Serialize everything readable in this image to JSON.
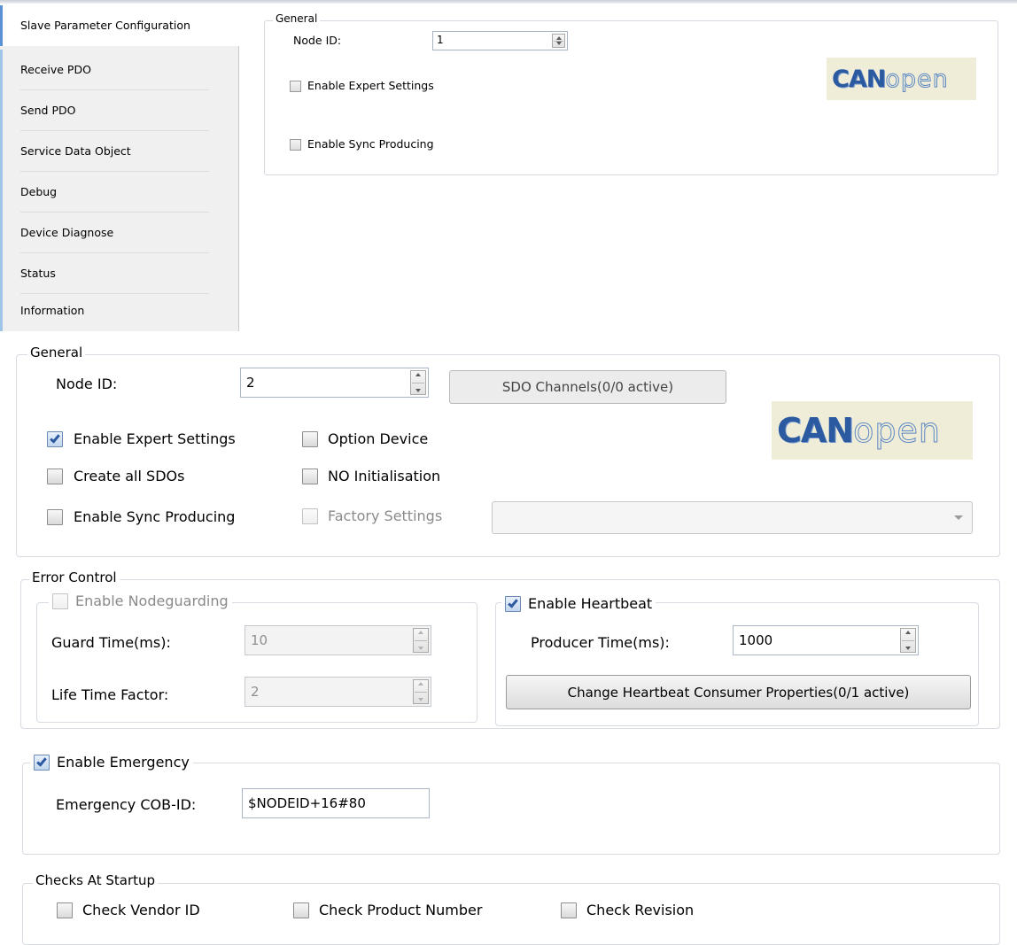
{
  "sidebar": {
    "items": [
      {
        "label": "Slave Parameter Configuration"
      },
      {
        "label": "Receive PDO"
      },
      {
        "label": "Send PDO"
      },
      {
        "label": "Service Data Object"
      },
      {
        "label": "Debug"
      },
      {
        "label": "Device Diagnose"
      },
      {
        "label": "Status"
      },
      {
        "label": "Information"
      }
    ]
  },
  "small_view": {
    "general_legend": "General",
    "node_id_label": "Node ID:",
    "node_id_value": "1",
    "enable_expert_label": "Enable Expert Settings",
    "enable_expert_checked": false,
    "enable_sync_label": "Enable Sync Producing",
    "enable_sync_checked": false,
    "logo_can": "CAN",
    "logo_open": "open"
  },
  "general": {
    "legend": "General",
    "node_id_label": "Node ID:",
    "node_id_value": "2",
    "sdo_button": "SDO Channels(0/0 active)",
    "enable_expert_label": "Enable Expert Settings",
    "enable_expert_checked": true,
    "option_device_label": "Option Device",
    "create_all_sdos_label": "Create all SDOs",
    "no_init_label": "NO Initialisation",
    "enable_sync_label": "Enable Sync Producing",
    "factory_settings_label": "Factory Settings",
    "factory_settings_value": "",
    "logo_can": "CAN",
    "logo_open": "open"
  },
  "error_control": {
    "legend": "Error Control",
    "nodeguarding_label": "Enable Nodeguarding",
    "nodeguarding_checked": false,
    "guard_time_label": "Guard Time(ms):",
    "guard_time_value": "10",
    "life_time_label": "Life Time Factor:",
    "life_time_value": "2",
    "heartbeat_label": "Enable Heartbeat",
    "heartbeat_checked": true,
    "producer_time_label": "Producer Time(ms):",
    "producer_time_value": "1000",
    "consumer_button": "Change Heartbeat Consumer Properties(0/1 active)"
  },
  "emergency": {
    "enable_label": "Enable Emergency",
    "enable_checked": true,
    "cob_id_label": "Emergency COB-ID:",
    "cob_id_value": "$NODEID+16#80"
  },
  "startup": {
    "legend": "Checks At Startup",
    "vendor_label": "Check Vendor ID",
    "product_label": "Check Product Number",
    "revision_label": "Check Revision"
  }
}
